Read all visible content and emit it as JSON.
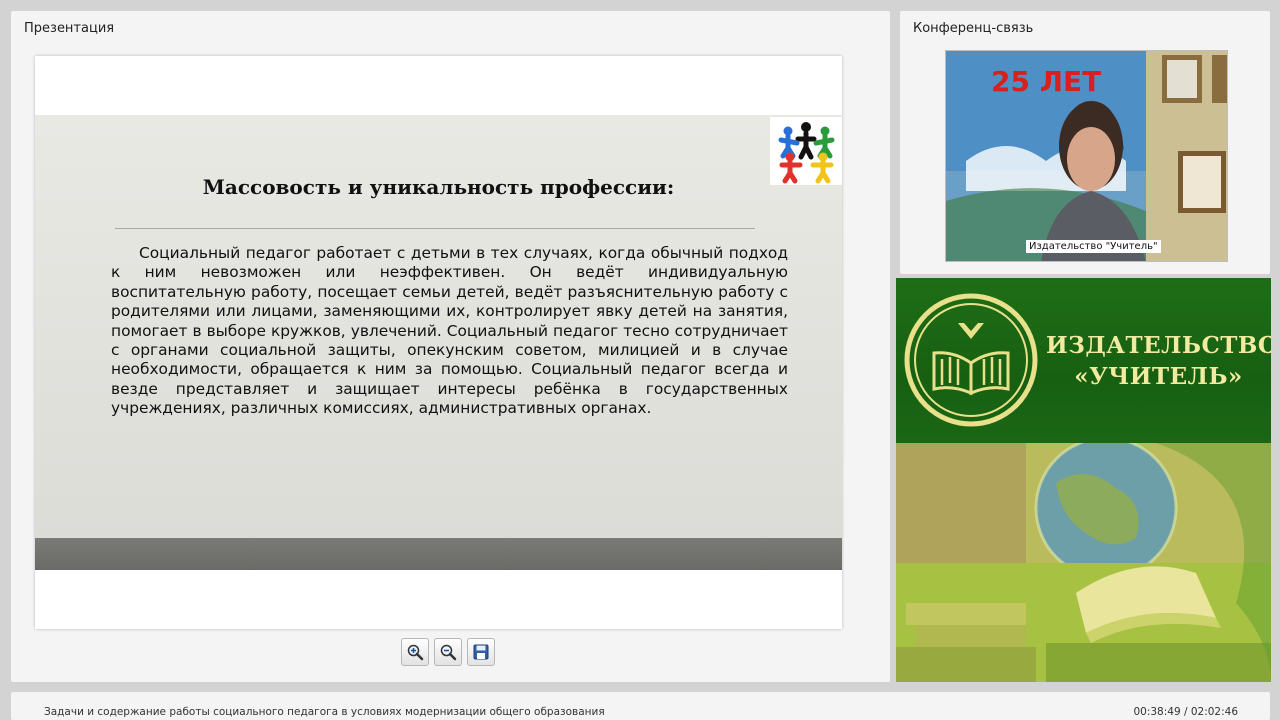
{
  "presentation": {
    "panel_title": "Презентация",
    "slide": {
      "heading": "Массовость и уникальность профессии:",
      "body": "Социальный педагог работает с детьми в тех случаях, когда обычный подход к ним невозможен или неэффективен. Он ведёт индивидуальную воспитательную работу, посещает семьи детей, ведёт разъяснительную работу с родителями или лицами, заменяющими их, контролирует явку детей на занятия, помогает в выборе кружков, увлечений. Социальный педагог тесно сотрудничает с органами социальной защиты, опекунским советом, милицией и в случае необходимости, обращается к ним за помощью. Социальный педагог всегда и везде представляет и защищает интересы ребёнка в государственных учреждениях, различных комиссиях, административных органах.",
      "logo_icon": "children-circle-logo-icon"
    },
    "toolbar": {
      "zoom_in_icon": "zoom-in-icon",
      "zoom_out_icon": "zoom-out-icon",
      "save_icon": "floppy-disk-icon"
    }
  },
  "conference": {
    "panel_title": "Конференц-связь",
    "speaker_label": "Издательство \"Учитель\""
  },
  "brand": {
    "line1": "ИЗДАТЕЛЬСТВО",
    "line2": "«УЧИТЕЛЬ»",
    "logo_icon": "book-emblem-logo-icon"
  },
  "status": {
    "course_title": "Задачи и содержание работы социального педагога в условиях модернизации общего образования",
    "time_current": "00:38:49",
    "time_total": "02:02:46",
    "timecode": "00:38:49 / 02:02:46"
  },
  "colors": {
    "brand_green": "#176012",
    "brand_text": "#f2eaa0",
    "slide_bar": "#6f6f6c"
  }
}
